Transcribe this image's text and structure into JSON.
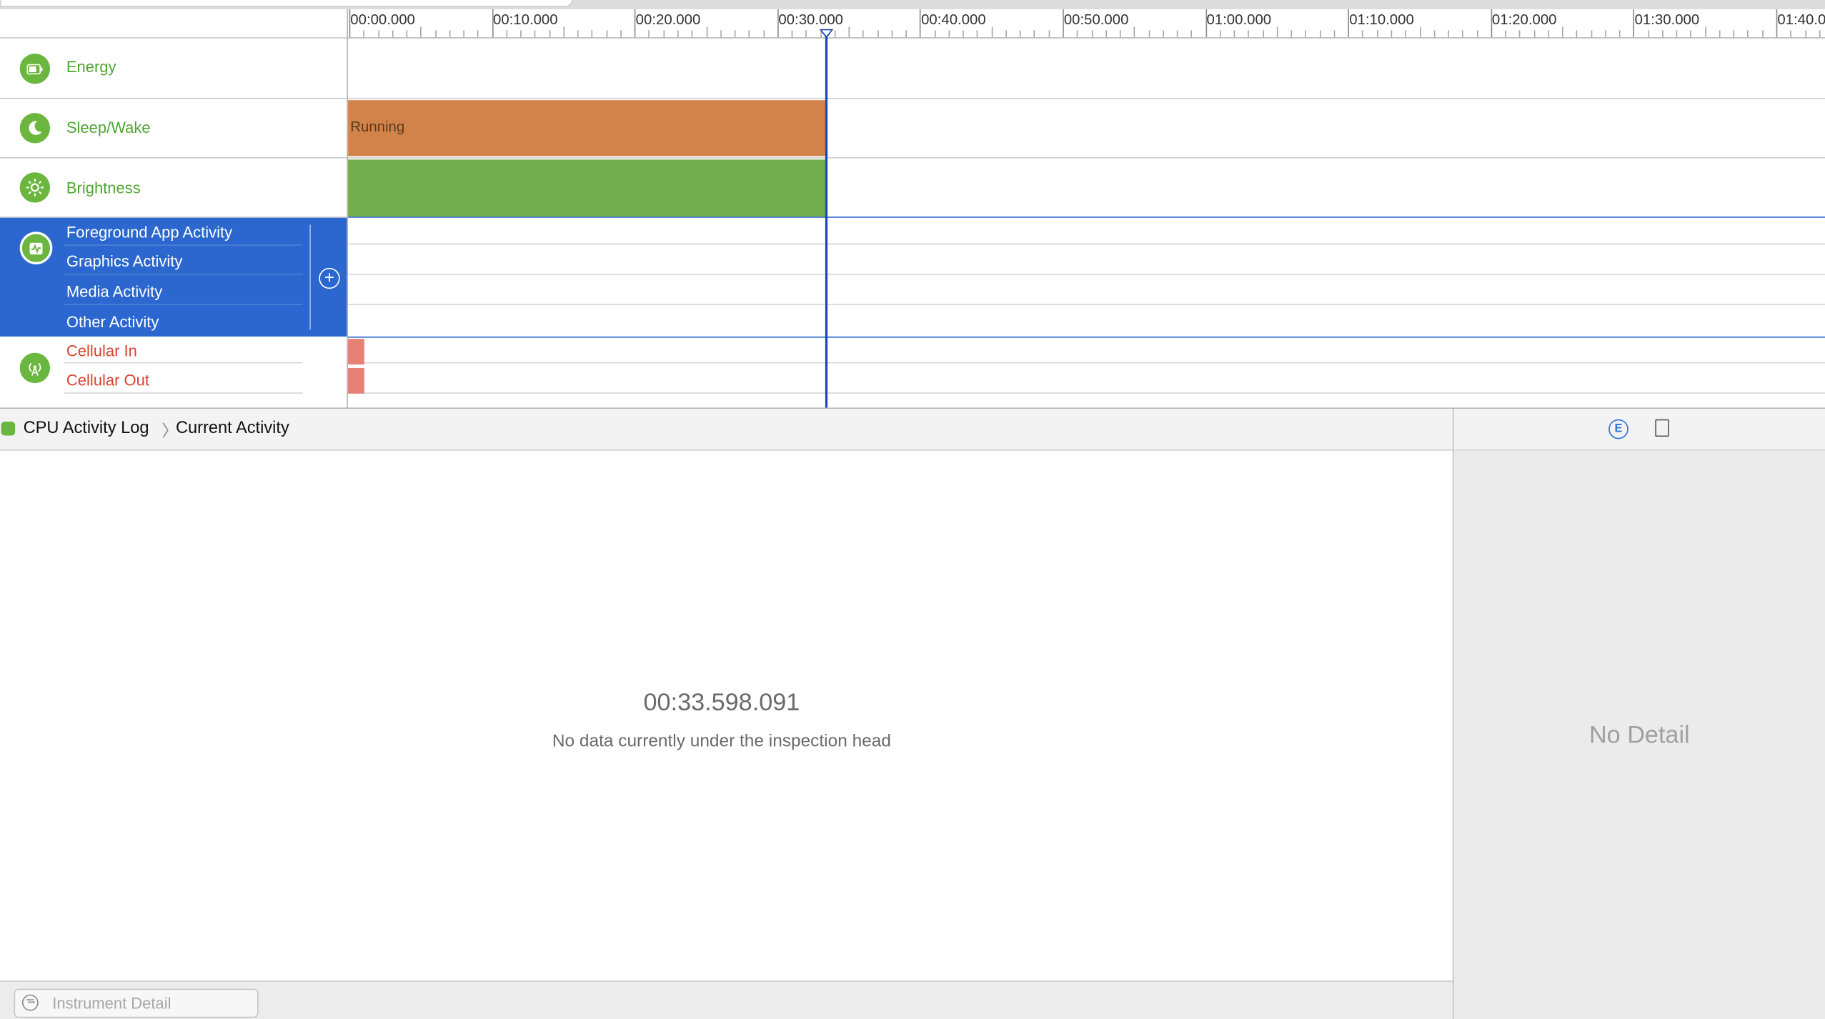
{
  "instruments": {
    "energy": {
      "label": "Energy",
      "icon": "battery-icon"
    },
    "sleep_wake": {
      "label": "Sleep/Wake",
      "icon": "moon-icon"
    },
    "brightness": {
      "label": "Brightness",
      "icon": "sun-icon"
    },
    "activity": {
      "icon": "activity-icon",
      "rows": [
        "Foreground App Activity",
        "Graphics Activity",
        "Media Activity",
        "Other Activity"
      ]
    },
    "network": {
      "icon": "antenna-icon",
      "rows": [
        "Cellular In",
        "Cellular Out"
      ]
    }
  },
  "timeline": {
    "ticks": [
      "00:00.000",
      "00:10.000",
      "00:20.000",
      "00:30.000",
      "00:40.000",
      "00:50.000",
      "01:00.000",
      "01:10.000",
      "01:20.000",
      "01:30.000",
      "01:40.0"
    ],
    "running_label": "Running",
    "colors": {
      "running": "#d2834a",
      "brightness": "#72ad4e",
      "cellular": "#e78176",
      "playhead": "#1d45b8"
    }
  },
  "detail": {
    "breadcrumb": [
      "CPU Activity Log",
      "Current Activity"
    ],
    "time": "00:33.598.091",
    "message": "No data currently under the inspection head",
    "filter_placeholder": "Instrument Detail"
  },
  "inspector": {
    "empty_label": "No Detail"
  }
}
